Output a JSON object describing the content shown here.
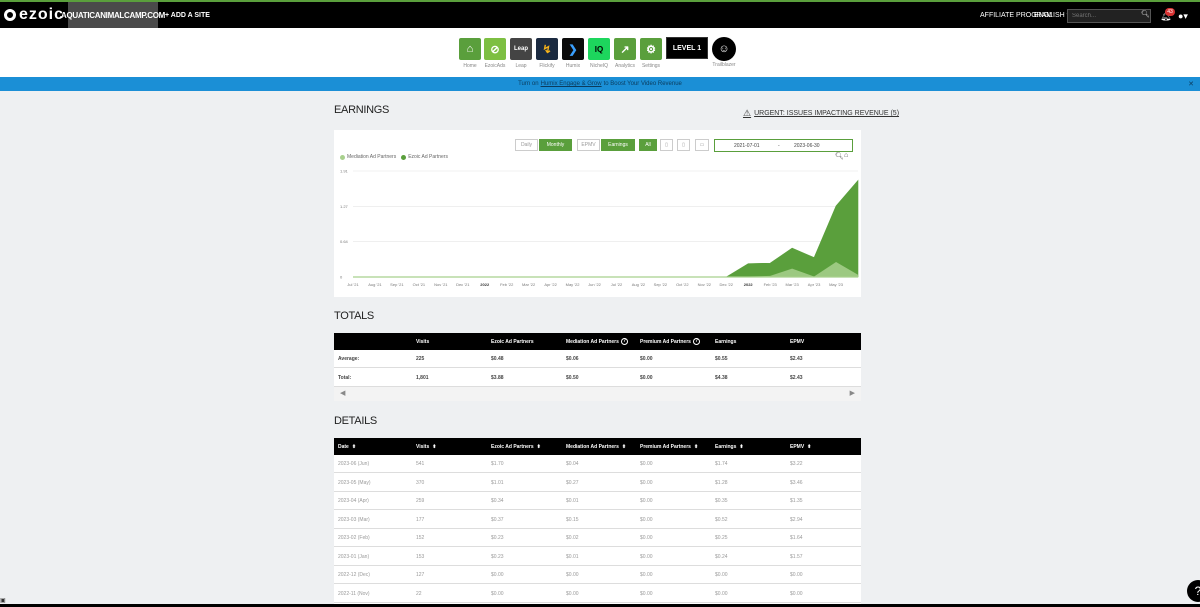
{
  "topbar": {
    "logo": "ezoic",
    "site": "AQUATICANIMALCAMP.COM",
    "add_site": "+ ADD A SITE",
    "affiliate": "AFFILIATE PROGRAM",
    "language": "ENGLISH ▾",
    "search_placeholder": "Search...",
    "notifications": "43"
  },
  "apps": [
    {
      "label": "Home",
      "color": "#5a9f3c"
    },
    {
      "label": "EzoicAds",
      "color": "#7dbf42"
    },
    {
      "label": "Leap",
      "color": "#444444"
    },
    {
      "label": "Flickify",
      "color": "#1b2a40"
    },
    {
      "label": "Humix",
      "color": "#0b0b0b"
    },
    {
      "label": "NicheIQ",
      "color": "#1dd65d"
    },
    {
      "label": "Analytics",
      "color": "#5a9f3c"
    },
    {
      "label": "Settings",
      "color": "#5a9f3c"
    }
  ],
  "level_badge": "LEVEL 1",
  "trailblazer_label": "Trailblazer",
  "banner": {
    "pre": "Turn on",
    "link": "Humix Engage & Grow",
    "post": "to Boost Your Video Revenue"
  },
  "earnings": {
    "title": "EARNINGS",
    "urgent": "URGENT: ISSUES IMPACTING REVENUE (5)",
    "buttons": {
      "daily": "Daily",
      "monthly": "Monthly",
      "epmv": "EPMV",
      "earnings": "Earnings",
      "all": "All"
    },
    "start_date": "2021-07-01",
    "end_date": "2023-06-30",
    "date_sep": "-"
  },
  "chart_data": {
    "type": "area",
    "x": [
      "Jul '21",
      "Aug '21",
      "Sep '21",
      "Oct '21",
      "Nov '21",
      "Dec '21",
      "2022",
      "Feb '22",
      "Mar '22",
      "Apr '22",
      "May '22",
      "Jun '22",
      "Jul '22",
      "Aug '22",
      "Sep '22",
      "Oct '22",
      "Nov '22",
      "Dec '22",
      "2022",
      "Feb '23",
      "Mar '23",
      "Apr '23",
      "May '23",
      "Jun '23"
    ],
    "tick_labels": [
      "Jul '21",
      "Aug '21",
      "Sep '21",
      "Oct '21",
      "Nov '21",
      "Dec '21",
      "2022",
      "Feb '22",
      "Mar '22",
      "Apr '22",
      "May '22",
      "Jun '22",
      "Jul '22",
      "Aug '22",
      "Sep '22",
      "Oct '22",
      "Nov '22",
      "Dec '22",
      "2022",
      "Feb '23",
      "Mar '23",
      "Apr '23",
      "May '23"
    ],
    "y_ticks": [
      "0",
      "0.64",
      "1.27",
      "1.91"
    ],
    "ylim": [
      0,
      1.91
    ],
    "series": [
      {
        "name": "Mediation Ad Partners",
        "color": "#a8d08d",
        "values": [
          0,
          0,
          0,
          0,
          0,
          0,
          0,
          0,
          0,
          0,
          0,
          0,
          0,
          0,
          0,
          0,
          0,
          0,
          0.01,
          0.02,
          0.15,
          0.01,
          0.27,
          0.04
        ]
      },
      {
        "name": "Ezoic Ad Partners",
        "color": "#5a9f3c",
        "values": [
          0,
          0,
          0,
          0,
          0,
          0,
          0,
          0,
          0,
          0,
          0,
          0,
          0,
          0,
          0,
          0,
          0,
          0,
          0.23,
          0.23,
          0.37,
          0.34,
          1.01,
          1.7
        ]
      }
    ],
    "grid": true,
    "legend": "top-left"
  },
  "totals": {
    "title": "TOTALS",
    "headers": [
      "",
      "Visits",
      "Ezoic Ad Partners",
      "Mediation Ad Partners",
      "Premium Ad Partners",
      "Earnings",
      "EPMV"
    ],
    "rows": [
      {
        "label": "Average:",
        "visits": "225",
        "ezoic": "$0.48",
        "mediation": "$0.06",
        "premium": "$0.00",
        "earnings": "$0.55",
        "epmv": "$2.43"
      },
      {
        "label": "Total:",
        "visits": "1,801",
        "ezoic": "$3.88",
        "mediation": "$0.50",
        "premium": "$0.00",
        "earnings": "$4.38",
        "epmv": "$2.43"
      }
    ]
  },
  "details": {
    "title": "DETAILS",
    "headers": [
      "Date",
      "Visits",
      "Ezoic Ad Partners",
      "Mediation Ad Partners",
      "Premium Ad Partners",
      "Earnings",
      "EPMV"
    ],
    "rows": [
      [
        "2023-06 (Jun)",
        "541",
        "$1.70",
        "$0.04",
        "$0.00",
        "$1.74",
        "$3.22"
      ],
      [
        "2023-05 (May)",
        "370",
        "$1.01",
        "$0.27",
        "$0.00",
        "$1.28",
        "$3.46"
      ],
      [
        "2023-04 (Apr)",
        "259",
        "$0.34",
        "$0.01",
        "$0.00",
        "$0.35",
        "$1.35"
      ],
      [
        "2023-03 (Mar)",
        "177",
        "$0.37",
        "$0.15",
        "$0.00",
        "$0.52",
        "$2.94"
      ],
      [
        "2023-02 (Feb)",
        "152",
        "$0.23",
        "$0.02",
        "$0.00",
        "$0.25",
        "$1.64"
      ],
      [
        "2023-01 (Jan)",
        "153",
        "$0.23",
        "$0.01",
        "$0.00",
        "$0.24",
        "$1.57"
      ],
      [
        "2022-12 (Dec)",
        "127",
        "$0.00",
        "$0.00",
        "$0.00",
        "$0.00",
        "$0.00"
      ],
      [
        "2022-11 (Nov)",
        "22",
        "$0.00",
        "$0.00",
        "$0.00",
        "$0.00",
        "$0.00"
      ]
    ]
  }
}
